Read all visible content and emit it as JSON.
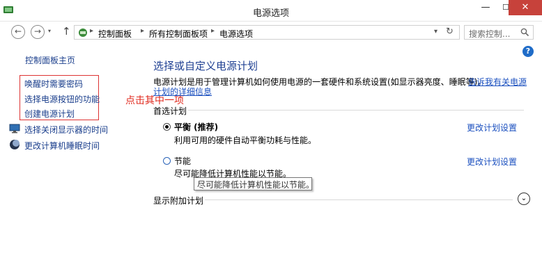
{
  "window": {
    "title": "电源选项",
    "minimize": "—",
    "maximize": "☐",
    "close": "✕"
  },
  "addressbar": {
    "back": "←",
    "forward": "→",
    "recent": "▾",
    "up": "↑",
    "breadcrumb": [
      "控制面板",
      "所有控制面板项",
      "电源选项"
    ],
    "separator": "▸",
    "dropdown": "▾",
    "refresh": "↻",
    "search_placeholder": "搜索控制..."
  },
  "sidebar": {
    "home": "控制面板主页",
    "links": [
      "唤醒时需要密码",
      "选择电源按钮的功能",
      "创建电源计划"
    ],
    "icon_links": [
      "选择关闭显示器的时间",
      "更改计算机睡眠时间"
    ],
    "annotation": "点击其中一项"
  },
  "main": {
    "help": "?",
    "heading": "选择或自定义电源计划",
    "description": "电源计划是用于管理计算机如何使用电源的一套硬件和系统设置(如显示器亮度、睡眠等)。",
    "description_link_part1": "告诉我有关电源",
    "description_link_part2": "计划的详细信息",
    "section_label": "首选计划",
    "plans": [
      {
        "name": "平衡 (推荐)",
        "desc": "利用可用的硬件自动平衡功耗与性能。",
        "link": "更改计划设置",
        "selected": true
      },
      {
        "name": "节能",
        "desc": "尽可能降低计算机性能以节能。",
        "link": "更改计划设置",
        "selected": false
      }
    ],
    "tooltip": "尽可能降低计算机性能以节能。",
    "extra_plans_label": "显示附加计划",
    "expand": "⌄"
  }
}
